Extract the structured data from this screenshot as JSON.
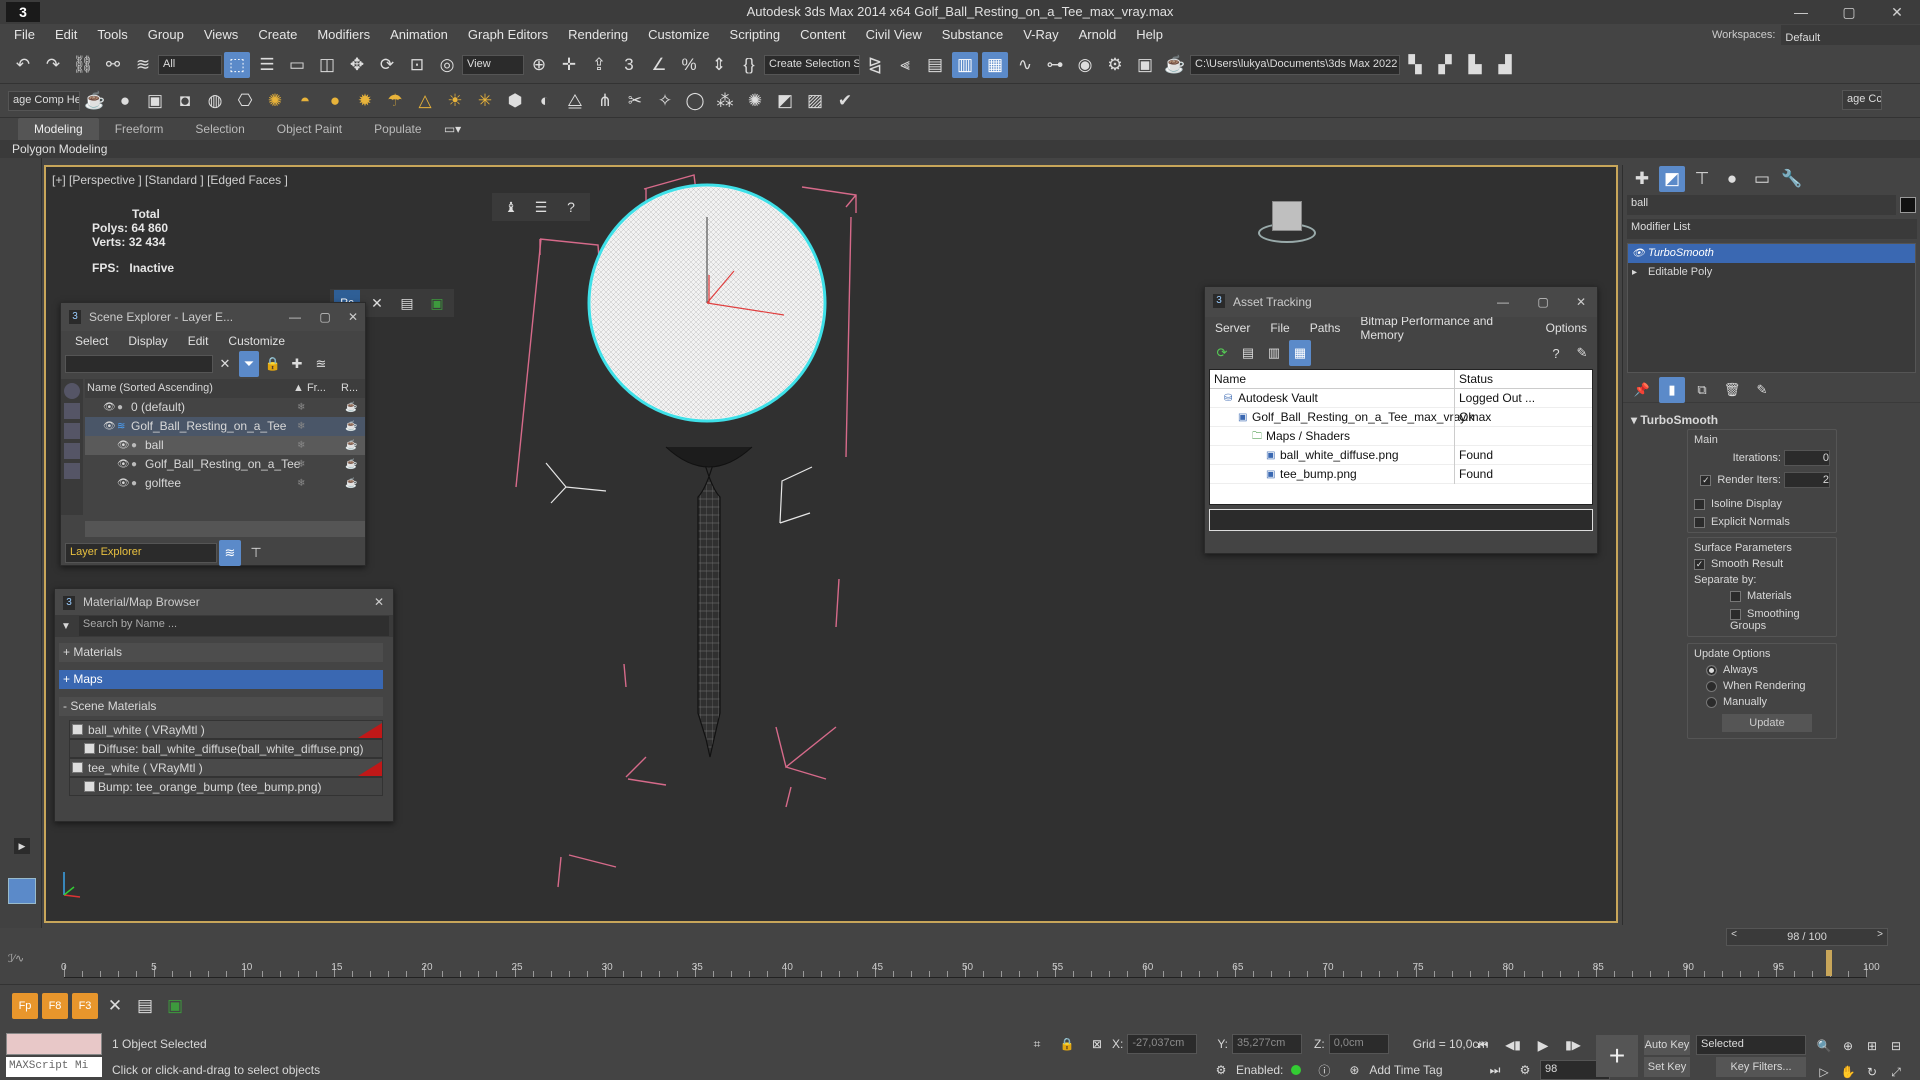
{
  "titlebar": {
    "logo": "3",
    "title": "Autodesk 3ds Max  2014 x64    Golf_Ball_Resting_on_a_Tee_max_vray.max",
    "min": "—",
    "max": "▢",
    "close": "✕"
  },
  "menu": [
    "File",
    "Edit",
    "Tools",
    "Group",
    "Views",
    "Create",
    "Modifiers",
    "Animation",
    "Graph Editors",
    "Rendering",
    "Customize",
    "Scripting",
    "Content",
    "Civil View",
    "Substance",
    "V-Ray",
    "Arnold",
    "Help"
  ],
  "workspace": {
    "label": "Workspaces:",
    "value": "Default"
  },
  "toolbar1": {
    "filter": "All",
    "view": "View",
    "selection_set": "Create Selection Se",
    "path": "C:\\Users\\lukya\\Documents\\3ds Max 2022"
  },
  "toolbar2": {
    "left_label": "age Comp Help",
    "right_label": "age Cc"
  },
  "ribbon": {
    "tabs": [
      "Modeling",
      "Freeform",
      "Selection",
      "Object Paint",
      "Populate"
    ],
    "active_tab": "Modeling",
    "sub": "Polygon Modeling"
  },
  "viewport": {
    "label": "[+] [Perspective ] [Standard ] [Edged Faces ]",
    "stats": {
      "total": "Total",
      "polys_label": "Polys:",
      "polys": "64 860",
      "verts_label": "Verts:",
      "verts": "32 434",
      "fps_label": "FPS:",
      "fps": "Inactive"
    }
  },
  "scene_explorer": {
    "title": "Scene Explorer - Layer E...",
    "menu": [
      "Select",
      "Display",
      "Edit",
      "Customize"
    ],
    "col_name": "Name (Sorted Ascending)",
    "col_fr": "▲ Fr...",
    "col_r": "R...",
    "rows": [
      {
        "name": "0 (default)",
        "indent": 1
      },
      {
        "name": "Golf_Ball_Resting_on_a_Tee",
        "indent": 1,
        "highlight": true
      },
      {
        "name": "ball",
        "indent": 2,
        "selected": true
      },
      {
        "name": "Golf_Ball_Resting_on_a_Tee",
        "indent": 2
      },
      {
        "name": "golftee",
        "indent": 2
      }
    ],
    "footer": "Layer Explorer"
  },
  "material_browser": {
    "title": "Material/Map Browser",
    "search_placeholder": "Search by Name ...",
    "sections": [
      "+ Materials",
      "+ Maps",
      "- Scene Materials"
    ],
    "items": [
      {
        "text": "ball_white  ( VRayMtl )",
        "level": 0
      },
      {
        "text": "Diffuse: ball_white_diffuse(ball_white_diffuse.png)",
        "level": 1
      },
      {
        "text": "tee_white  ( VRayMtl )",
        "level": 0
      },
      {
        "text": "Bump: tee_orange_bump (tee_bump.png)",
        "level": 1
      }
    ]
  },
  "asset_tracking": {
    "title": "Asset Tracking",
    "menu": [
      "Server",
      "File",
      "Paths",
      "Bitmap Performance and Memory",
      "Options"
    ],
    "col_name": "Name",
    "col_status": "Status",
    "rows": [
      {
        "name": "Autodesk Vault",
        "status": "Logged Out ...",
        "indent": 1
      },
      {
        "name": "Golf_Ball_Resting_on_a_Tee_max_vray.max",
        "status": "Ok",
        "indent": 2
      },
      {
        "name": "Maps / Shaders",
        "status": "",
        "indent": 3
      },
      {
        "name": "ball_white_diffuse.png",
        "status": "Found",
        "indent": 4
      },
      {
        "name": "tee_bump.png",
        "status": "Found",
        "indent": 4
      }
    ]
  },
  "command_panel": {
    "search": "ball",
    "modifier_list": "Modifier List",
    "stack": [
      {
        "name": "TurboSmooth",
        "selected": true
      },
      {
        "name": "Editable Poly",
        "selected": false
      }
    ],
    "rollout": "TurboSmooth",
    "main": "Main",
    "iterations_label": "Iterations:",
    "iterations": "0",
    "render_iters_label": "Render Iters:",
    "render_iters": "2",
    "isoline": "Isoline Display",
    "explicit": "Explicit Normals",
    "surface": "Surface Parameters",
    "smooth_result": "Smooth Result",
    "separate": "Separate by:",
    "materials": "Materials",
    "smoothing_groups": "Smoothing Groups",
    "update_options": "Update Options",
    "always": "Always",
    "when_rendering": "When Rendering",
    "manually": "Manually",
    "update": "Update"
  },
  "timeline": {
    "frame": "98 / 100",
    "ticks": [
      "0",
      "5",
      "10",
      "15",
      "20",
      "25",
      "30",
      "35",
      "40",
      "45",
      "50",
      "55",
      "60",
      "65",
      "70",
      "75",
      "80",
      "85",
      "90",
      "95",
      "100"
    ]
  },
  "status": {
    "maxscript": "MAXScript Mi",
    "selected": "1 Object Selected",
    "hint": "Click or click-and-drag to select objects",
    "x_label": "X:",
    "x": "-27,037cm",
    "y_label": "Y:",
    "y": "35,277cm",
    "z_label": "Z:",
    "z": "0,0cm",
    "grid": "Grid = 10,0cm",
    "enabled": "Enabled:",
    "add_time_tag": "Add Time Tag",
    "auto_key": "Auto Key",
    "set_key": "Set Key",
    "selected_dd": "Selected",
    "key_filters": "Key Filters...",
    "frame_field": "98"
  }
}
